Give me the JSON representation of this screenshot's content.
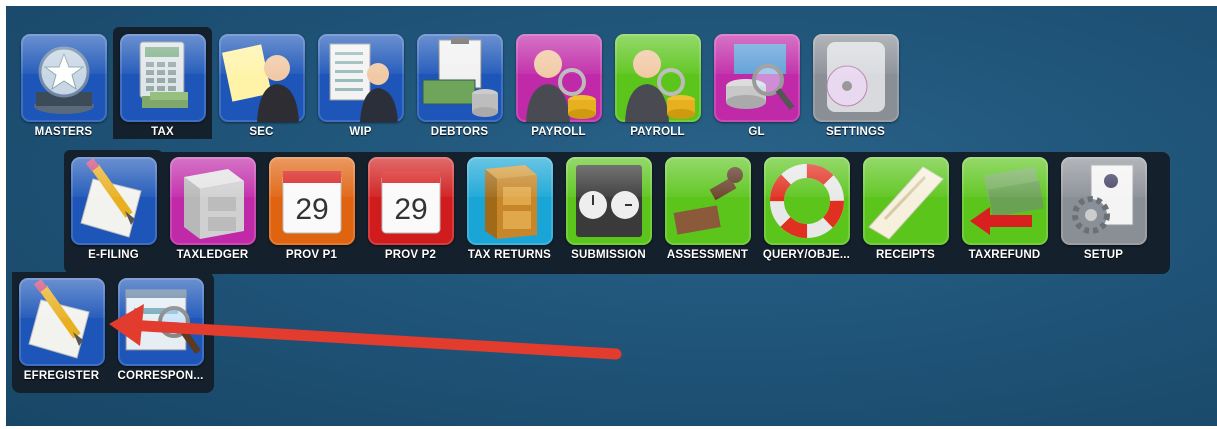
{
  "top_menu": [
    {
      "label": "MASTERS",
      "icon": "star-icon",
      "color": "#1d56b8"
    },
    {
      "label": "TAX",
      "icon": "calculator-icon",
      "color": "#1d56b8"
    },
    {
      "label": "SEC",
      "icon": "secretary-icon",
      "color": "#1d56b8"
    },
    {
      "label": "WIP",
      "icon": "business-person-icon",
      "color": "#1d56b8"
    },
    {
      "label": "DEBTORS",
      "icon": "money-clipboard-icon",
      "color": "#1d56b8"
    },
    {
      "label": "PAYROLL",
      "icon": "payroll-person-icon",
      "color": "#c02aa8"
    },
    {
      "label": "PAYROLL",
      "icon": "payroll-person-icon",
      "color": "#5cc51c"
    },
    {
      "label": "GL",
      "icon": "coins-magnifier-icon",
      "color": "#c02aa8"
    },
    {
      "label": "SETTINGS",
      "icon": "settings-disc-icon",
      "color": "#8a8f96"
    }
  ],
  "tax_submenu": [
    {
      "label": "E-FILING",
      "icon": "pencil-paper-icon",
      "color": "#1d56b8"
    },
    {
      "label": "TAXLEDGER",
      "icon": "filing-cabinet-icon",
      "color": "#c02aa8"
    },
    {
      "label": "PROV P1",
      "icon": "calendar-icon",
      "color": "#e0630f",
      "day": "29"
    },
    {
      "label": "PROV P2",
      "icon": "calendar-icon",
      "color": "#d01c1c",
      "day": "29"
    },
    {
      "label": "TAX RETURNS",
      "icon": "file-drawer-icon",
      "color": "#19a6d6"
    },
    {
      "label": "SUBMISSION",
      "icon": "world-clock-icon",
      "color": "#5cc51c"
    },
    {
      "label": "ASSESSMENT",
      "icon": "stamp-icon",
      "color": "#5cc51c"
    },
    {
      "label": "QUERY/OBJE...",
      "icon": "lifebuoy-icon",
      "color": "#5cc51c"
    },
    {
      "label": "RECEIPTS",
      "icon": "receipt-icon",
      "color": "#5cc51c"
    },
    {
      "label": "TAXREFUND",
      "icon": "money-arrow-icon",
      "color": "#5cc51c"
    },
    {
      "label": "SETUP",
      "icon": "setup-gear-icon",
      "color": "#8a8f96"
    }
  ],
  "efiling_submenu": [
    {
      "label": "EFREGISTER",
      "icon": "pencil-paper-icon",
      "color": "#1d56b8"
    },
    {
      "label": "CORRESPON...",
      "icon": "window-magnifier-icon",
      "color": "#1d56b8"
    }
  ]
}
